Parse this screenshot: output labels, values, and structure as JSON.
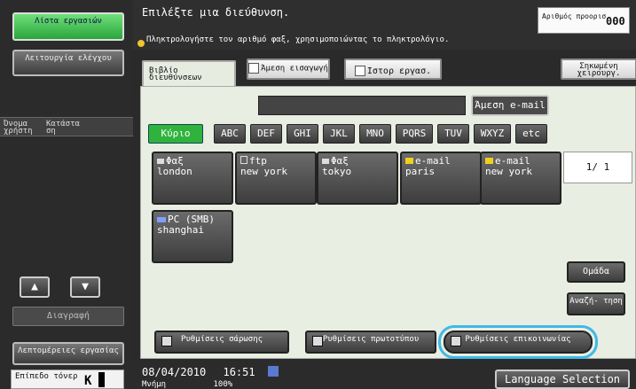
{
  "left": {
    "jobs_label": "Λίστα εργασιών",
    "check_label": "Λειτουργία ελέγχου",
    "user_label": "Όνομα χρήστη",
    "status_label": "Κατάστα ση",
    "delete_label": "Διαγραφή",
    "details_label": "Λεπτομέρειες εργασίας",
    "level_label": "Επίπεδο τόνερ",
    "level_letter": "K"
  },
  "header": {
    "prompt": "Επιλέξτε μια διεύθυνση.",
    "hint": "Πληκτρολογήστε τον αριθμό φαξ, χρησιμοποιώντας το πληκτρολόγιο.",
    "counter_label": "Αριθμός προορισ.",
    "counter_value": "000"
  },
  "tabs": {
    "book": "Βιβλίο διευθύνσεων",
    "direct": "Άμεση εισαγωγή",
    "history": "Ιστορ εργασ.",
    "manual": "Σηκωμένη χειρουργ."
  },
  "search": {
    "email_button": "Άμεση e-mail"
  },
  "letters": [
    "Κύριο",
    "ABC",
    "DEF",
    "GHI",
    "JKL",
    "MNO",
    "PQRS",
    "TUV",
    "WXYZ",
    "etc"
  ],
  "destinations": [
    {
      "type": "Φαξ",
      "name": "london",
      "icon": "fax-icon"
    },
    {
      "type": "ftp",
      "name": "new york",
      "icon": "ftp-icon"
    },
    {
      "type": "Φαξ",
      "name": "tokyo",
      "icon": "fax-icon"
    },
    {
      "type": "e-mail",
      "name": "paris",
      "icon": "email-icon"
    },
    {
      "type": "e-mail",
      "name": "new york",
      "icon": "email-icon"
    },
    {
      "type": "PC (SMB)",
      "name": "shanghai",
      "icon": "pc-icon"
    }
  ],
  "page": {
    "current": "1/",
    "total": "1"
  },
  "side": {
    "group_label": "Ομάδα",
    "search_label": "Αναζή- τηση"
  },
  "settings": {
    "scan_label": "Ρυθμίσεις σάρωσης",
    "original_label": "Ρυθμίσεις πρωτοτύπου",
    "comm_label": "Ρυθμίσεις επικοινωνίας"
  },
  "footer": {
    "date": "08/04/2010",
    "time": "16:51",
    "memory_label": "Μνήμη",
    "memory_value": "100%",
    "language_button": "Language Selection"
  },
  "colors": {
    "accent_green": "#2fb33c",
    "highlight_ring": "#3fb9e8"
  }
}
